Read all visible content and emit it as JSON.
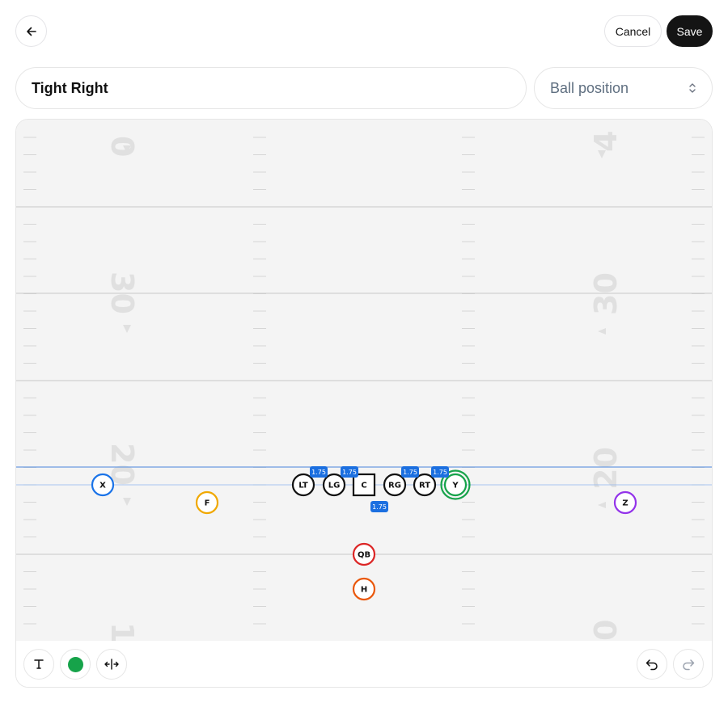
{
  "header": {
    "cancel_label": "Cancel",
    "save_label": "Save"
  },
  "formation": {
    "name": "Tight Right",
    "ball_position_label": "Ball position"
  },
  "field": {
    "yard_numbers_left": [
      "0",
      "30",
      "20",
      "1"
    ],
    "yard_numbers_right": [
      "4",
      "30",
      "20",
      "0"
    ]
  },
  "players": [
    {
      "id": "X",
      "label": "X",
      "color": "#1a73e8",
      "shape": "circle"
    },
    {
      "id": "F",
      "label": "F",
      "color": "#f0a800",
      "shape": "circle"
    },
    {
      "id": "LT",
      "label": "LT",
      "color": "#111111",
      "shape": "circle"
    },
    {
      "id": "LG",
      "label": "LG",
      "color": "#111111",
      "shape": "circle"
    },
    {
      "id": "C",
      "label": "C",
      "color": "#111111",
      "shape": "square"
    },
    {
      "id": "RG",
      "label": "RG",
      "color": "#111111",
      "shape": "circle"
    },
    {
      "id": "RT",
      "label": "RT",
      "color": "#111111",
      "shape": "circle"
    },
    {
      "id": "Y",
      "label": "Y",
      "color": "#16a34a",
      "shape": "double-circle"
    },
    {
      "id": "Z",
      "label": "Z",
      "color": "#9333ea",
      "shape": "circle"
    },
    {
      "id": "QB",
      "label": "QB",
      "color": "#dc2626",
      "shape": "circle"
    },
    {
      "id": "H",
      "label": "H",
      "color": "#ea580c",
      "shape": "circle"
    }
  ],
  "spacing_badges": [
    "1.75",
    "1.75",
    "1.75",
    "1.75",
    "1.75"
  ],
  "tools": {
    "text_icon": "text-tool-icon",
    "color_icon": "color-swatch",
    "color_value": "#16a34a",
    "move_icon": "move-arrows-icon",
    "undo_icon": "undo-icon",
    "redo_icon": "redo-icon"
  }
}
